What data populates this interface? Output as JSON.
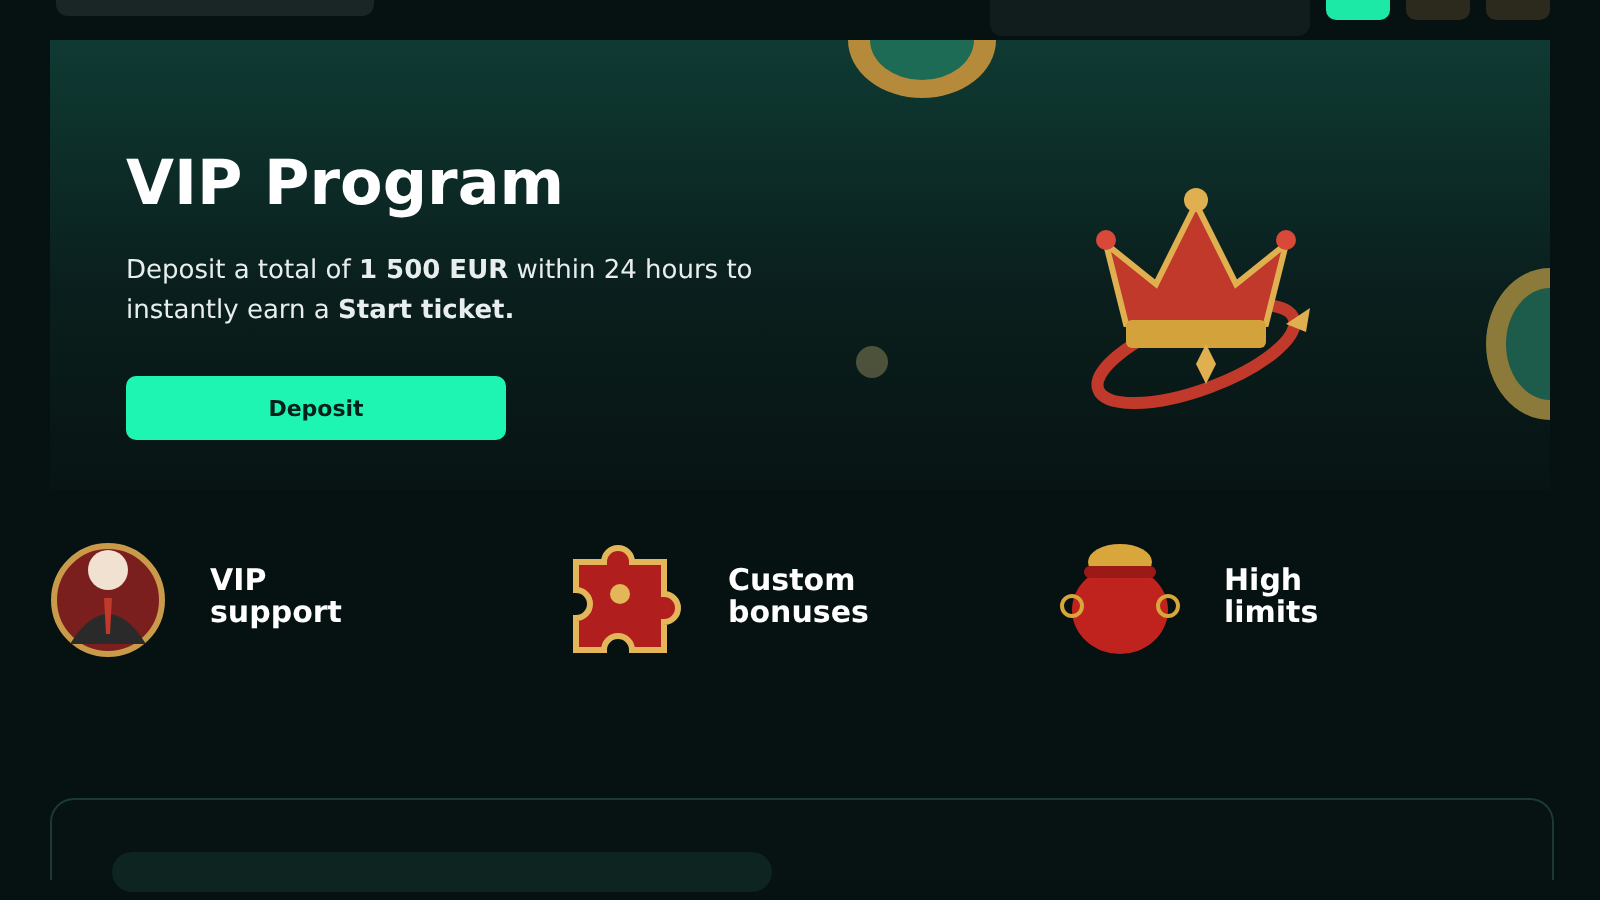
{
  "hero": {
    "title": "VIP Program",
    "description": "Deposit a total of **1 500 EUR** within 24 hours to instantly earn a **Start ticket.**",
    "button": "Deposit"
  },
  "features": [
    {
      "kind": "avatar",
      "label": "VIP support"
    },
    {
      "kind": "puzzle",
      "label": "Custom bonuses"
    },
    {
      "kind": "pot",
      "label": "High limits"
    }
  ]
}
